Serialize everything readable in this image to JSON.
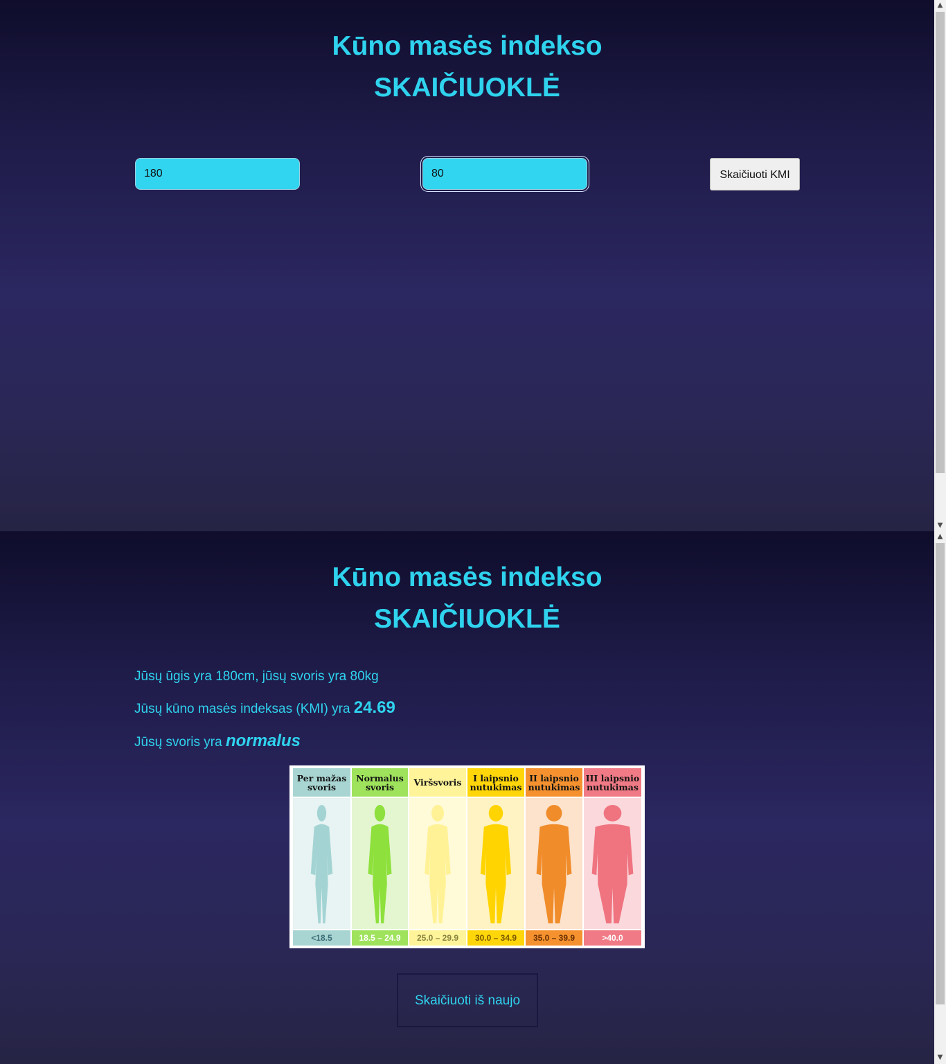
{
  "colors": {
    "accent": "#2fd3ee",
    "input_bg": "#31d5f0",
    "background_top": "#0f0d2b",
    "background_mid": "#2b2760"
  },
  "form_view": {
    "title_line1": "Kūno masės indekso",
    "title_line2": "SKAIČIUOKLĖ",
    "height_value": "180",
    "weight_value": "80",
    "calculate_button": "Skaičiuoti KMI"
  },
  "result_view": {
    "title_line1": "Kūno masės indekso",
    "title_line2": "SKAIČIUOKLĖ",
    "line1": "Jūsų ūgis yra 180cm, jūsų svoris yra 80kg",
    "line2_prefix": "Jūsų kūno masės indeksas (KMI) yra ",
    "bmi_value": "24.69",
    "line3_prefix": "Jūsų svoris yra ",
    "category": "normalus",
    "recalculate_button": "Skaičiuoti iš naujo"
  },
  "bmi_chart": {
    "columns": [
      {
        "label": "Per mažas\nsvoris",
        "range": "<18.5",
        "head_color": "#a8d5d2",
        "body_color": "#e8f3f3",
        "figure_color": "#a3d4d3",
        "foot_color": "#a8d5d2",
        "text_color": "#3c6c76"
      },
      {
        "label": "Normalus\nsvoris",
        "range": "18.5 – 24.9",
        "head_color": "#9fe35c",
        "body_color": "#e3f6d0",
        "figure_color": "#8ee03c",
        "foot_color": "#9fe35c",
        "text_color": "#ffffff"
      },
      {
        "label": "Viršsvoris",
        "range": "25.0 – 29.9",
        "head_color": "#fff49a",
        "body_color": "#fffbd9",
        "figure_color": "#fff296",
        "foot_color": "#fff49a",
        "text_color": "#8a8440"
      },
      {
        "label": "I laipsnio\nnutukimas",
        "range": "30.0 – 34.9",
        "head_color": "#ffd60a",
        "body_color": "#fff3c4",
        "figure_color": "#ffd400",
        "foot_color": "#ffd60a",
        "text_color": "#7a5a00"
      },
      {
        "label": "II laipsnio\nnutukimas",
        "range": "35.0 – 39.9",
        "head_color": "#f5922f",
        "body_color": "#fde2cc",
        "figure_color": "#f08c2a",
        "foot_color": "#f5922f",
        "text_color": "#6a2f00"
      },
      {
        "label": "III laipsnio\nnutukimas",
        "range": ">40.0",
        "head_color": "#f07a85",
        "body_color": "#fbd8dc",
        "figure_color": "#ef7480",
        "foot_color": "#f07a85",
        "text_color": "#ffffff"
      }
    ]
  }
}
